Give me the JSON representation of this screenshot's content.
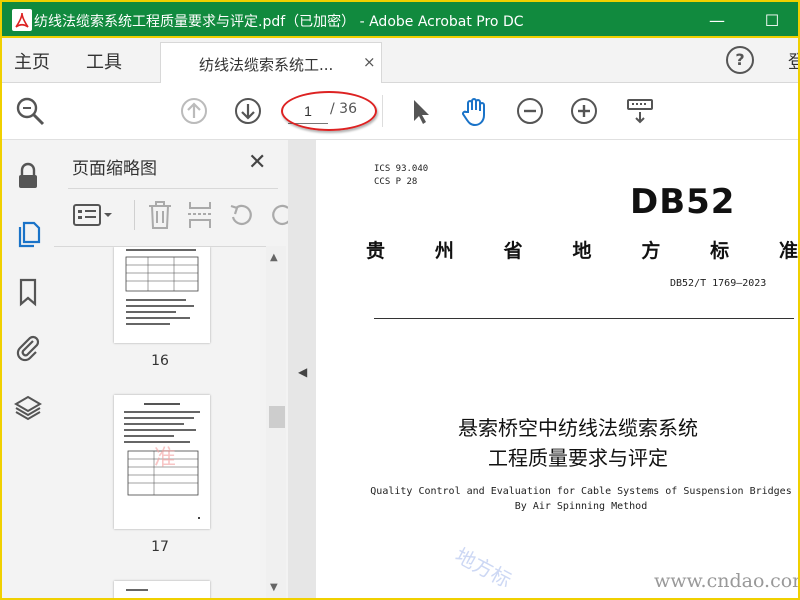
{
  "window": {
    "title": "纺线法缆索系统工程质量要求与评定.pdf（已加密） - Adobe Acrobat Pro DC",
    "minimize": "—",
    "maximize": "☐"
  },
  "tabs": {
    "home": "主页",
    "tools": "工具",
    "document": "纺线法缆索系统工...",
    "close": "×",
    "help": "?",
    "signin": "登"
  },
  "toolbar": {
    "current_page": "1",
    "total_pages": "/ 36"
  },
  "panel": {
    "title": "页面缩略图",
    "close": "✕",
    "thumbnails": [
      {
        "label": "16"
      },
      {
        "label": "17"
      }
    ]
  },
  "document": {
    "ics": "ICS 93.040",
    "ccs": "CCS P 28",
    "code": "DB52",
    "province_chars": [
      "贵",
      "州",
      "省",
      "地",
      "方",
      "标",
      "准"
    ],
    "standard_number": "DB52/T 1769—2023",
    "title_line1": "悬索桥空中纺线法缆索系统",
    "title_line2": "工程质量要求与评定",
    "english_line1": "Quality Control and Evaluation for Cable Systems of Suspension Bridges",
    "english_line2": "By Air Spinning Method",
    "watermark_text": "地方标",
    "watermark_url": "www.cndao.com"
  },
  "colors": {
    "titlebar": "#118a3e",
    "border": "#f0d000",
    "accent_blue": "#1a73c8",
    "annotation_red": "#d22222"
  }
}
